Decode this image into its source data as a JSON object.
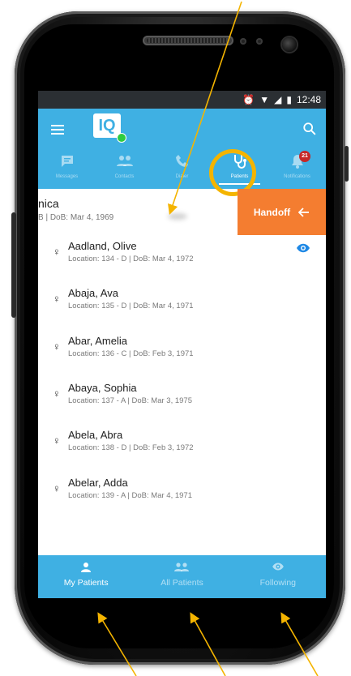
{
  "status_bar": {
    "time": "12:48",
    "icons": [
      "alarm-icon",
      "wifi-icon",
      "signal-icon",
      "battery-icon"
    ]
  },
  "app_bar": {
    "logo_text": "IQ",
    "menu_icon": "menu-icon",
    "search_icon": "search-icon",
    "tabs": [
      {
        "label": "Messages",
        "icon": "message-icon",
        "active": false
      },
      {
        "label": "Contacts",
        "icon": "contacts-icon",
        "active": false
      },
      {
        "label": "Dialer",
        "icon": "phone-icon",
        "active": false
      },
      {
        "label": "Patients",
        "icon": "stethoscope-icon",
        "active": true
      },
      {
        "label": "Notifications",
        "icon": "bell-icon",
        "active": false,
        "badge": "21"
      }
    ]
  },
  "swiped_row": {
    "name": "nica",
    "subtitle": "B | DoB: Mar 4, 1969",
    "action_label": "Handoff"
  },
  "patients": [
    {
      "name": "Aadland, Olive",
      "info": "Location: 134 - D | DoB: Mar 4, 1972",
      "following": true
    },
    {
      "name": "Abaja, Ava",
      "info": "Location: 135 - D | DoB: Mar 4, 1971",
      "following": false
    },
    {
      "name": "Abar, Amelia",
      "info": "Location: 136 - C | DoB: Feb 3, 1971",
      "following": false
    },
    {
      "name": "Abaya, Sophia",
      "info": "Location: 137 - A | DoB: Mar 3, 1975",
      "following": false
    },
    {
      "name": "Abela, Abra",
      "info": "Location: 138 - D | DoB: Feb 3, 1972",
      "following": false
    },
    {
      "name": "Abelar, Adda",
      "info": "Location: 139 - A | DoB: Mar 4, 1971",
      "following": false
    }
  ],
  "bottom_nav": [
    {
      "label": "My Patients",
      "icon": "person-icon",
      "active": true
    },
    {
      "label": "All Patients",
      "icon": "people-icon",
      "active": false
    },
    {
      "label": "Following",
      "icon": "eye-icon",
      "active": false
    }
  ],
  "colors": {
    "app_bar": "#3fb0e3",
    "handoff": "#f47d30",
    "highlight": "#f4b400",
    "badge": "#c62828",
    "eye": "#1e88e5"
  }
}
